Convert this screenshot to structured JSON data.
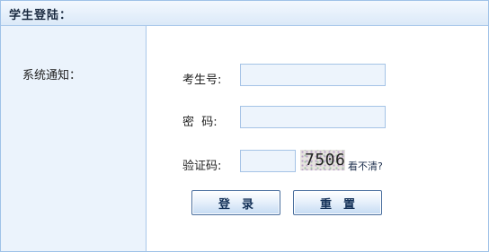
{
  "header": {
    "title": "学生登陆："
  },
  "sidebar": {
    "notice_title": "系统通知："
  },
  "form": {
    "exam_id_label": "考生号:",
    "password_label": "密  码:",
    "captcha_label": "验证码:",
    "exam_id_value": "",
    "password_value": "",
    "captcha_value": "",
    "captcha_code": "7506",
    "refresh_captcha_link": "看不清?",
    "login_button": "登录",
    "reset_button": "重置"
  },
  "colors": {
    "border": "#a9c8ea",
    "sidebar_bg": "#ebf3fc",
    "input_bg": "#edf4fc",
    "button_text": "#143158"
  }
}
